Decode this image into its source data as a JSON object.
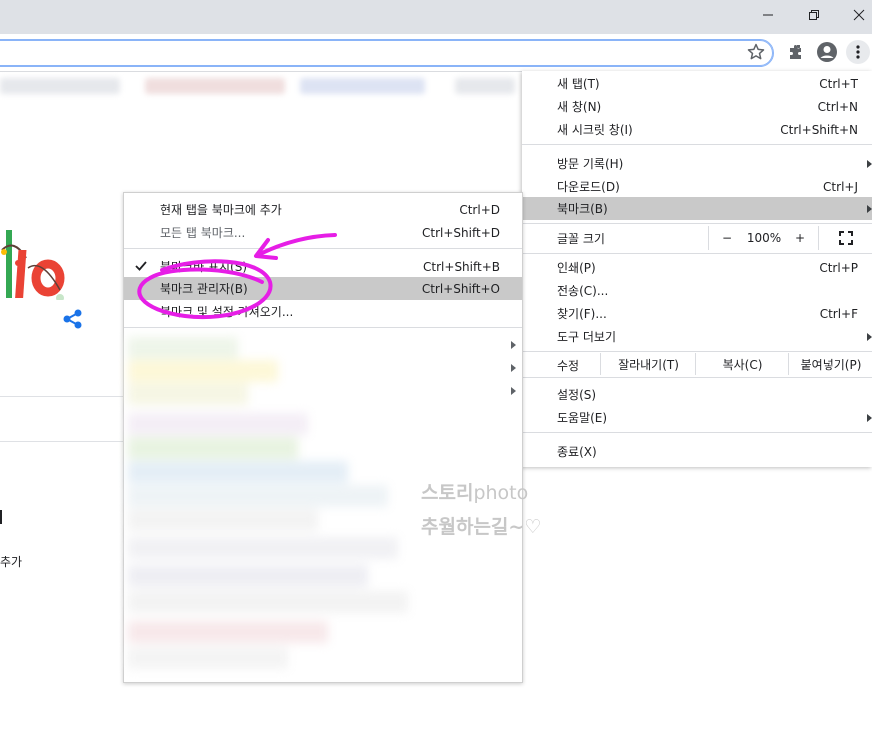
{
  "window": {
    "min_icon": "minimize-icon",
    "max_icon": "restore-icon",
    "close_icon": "close-icon"
  },
  "toolbar": {
    "icons": [
      "star-icon",
      "extensions-icon",
      "profile-icon",
      "more-vert-icon"
    ]
  },
  "page": {
    "left_fragment": "추가"
  },
  "main_menu": {
    "new_tab": {
      "label": "새 탭(T)",
      "shortcut": "Ctrl+T"
    },
    "new_window": {
      "label": "새 창(N)",
      "shortcut": "Ctrl+N"
    },
    "incognito": {
      "label": "새 시크릿 창(I)",
      "shortcut": "Ctrl+Shift+N"
    },
    "history": {
      "label": "방문 기록(H)"
    },
    "downloads": {
      "label": "다운로드(D)",
      "shortcut": "Ctrl+J"
    },
    "bookmarks": {
      "label": "북마크(B)"
    },
    "zoom": {
      "label": "글꼴 크기",
      "minus": "−",
      "value": "100%",
      "plus": "+"
    },
    "print": {
      "label": "인쇄(P)",
      "shortcut": "Ctrl+P"
    },
    "cast": {
      "label": "전송(C)..."
    },
    "find": {
      "label": "찾기(F)...",
      "shortcut": "Ctrl+F"
    },
    "more_tools": {
      "label": "도구 더보기"
    },
    "edit": {
      "label": "수정",
      "cut": "잘라내기(T)",
      "copy": "복사(C)",
      "paste": "붙여넣기(P)"
    },
    "settings": {
      "label": "설정(S)"
    },
    "help": {
      "label": "도움말(E)"
    },
    "exit": {
      "label": "종료(X)"
    }
  },
  "bookmark_menu": {
    "add_tab": {
      "label": "현재 탭을 북마크에 추가",
      "shortcut": "Ctrl+D"
    },
    "add_all": {
      "label": "모든 탭 북마크...",
      "shortcut": "Ctrl+Shift+D"
    },
    "show_bar": {
      "label": "북마크바 표시(S)",
      "shortcut": "Ctrl+Shift+B"
    },
    "manager": {
      "label": "북마크 관리자(B)",
      "shortcut": "Ctrl+Shift+O"
    },
    "import": {
      "label": "북마크 및 설정 가져오기..."
    }
  },
  "watermark": {
    "line1_kr": "스토리",
    "line1_en": "photo",
    "line2": "추월하는길~♡"
  },
  "colors": {
    "highlight": "#c9c9c9",
    "annotation": "#e61ee6",
    "omnibox_focus": "#8ab4f8"
  }
}
